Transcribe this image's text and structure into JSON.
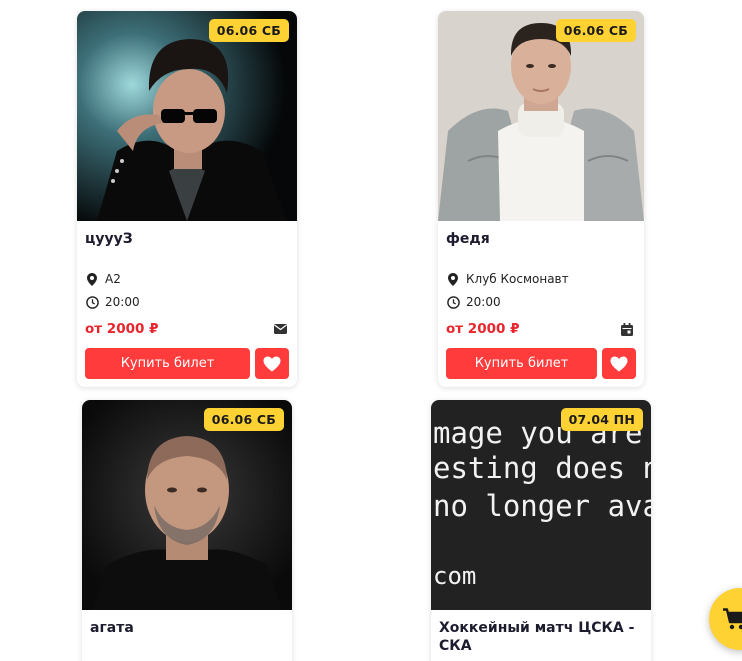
{
  "events": [
    {
      "date": "06.06 СБ",
      "title": "цуууЗ",
      "venue": "А2",
      "time": "20:00",
      "price": "от 2000 ₽",
      "buy_label": "Купить билет",
      "extra_icon": "envelope-icon"
    },
    {
      "date": "06.06 СБ",
      "title": "федя",
      "venue": "Клуб Космонавт",
      "time": "20:00",
      "price": "от 2000 ₽",
      "buy_label": "Купить билет",
      "extra_icon": "calendar-icon"
    },
    {
      "date": "06.06 СБ",
      "title": "агата"
    },
    {
      "date": "07.04 ПН",
      "title": "Хоккейный матч ЦСКА - СКА",
      "placeholder_image_text": [
        "mage you are",
        "esting does not",
        "no longer avail",
        "com"
      ]
    }
  ],
  "colors": {
    "accent_red": "#ff3b3b",
    "price_red": "#e8262d",
    "badge_yellow": "#ffd233",
    "title_text": "#1c1c2e"
  },
  "cart_button": {
    "icon": "cart-icon"
  }
}
